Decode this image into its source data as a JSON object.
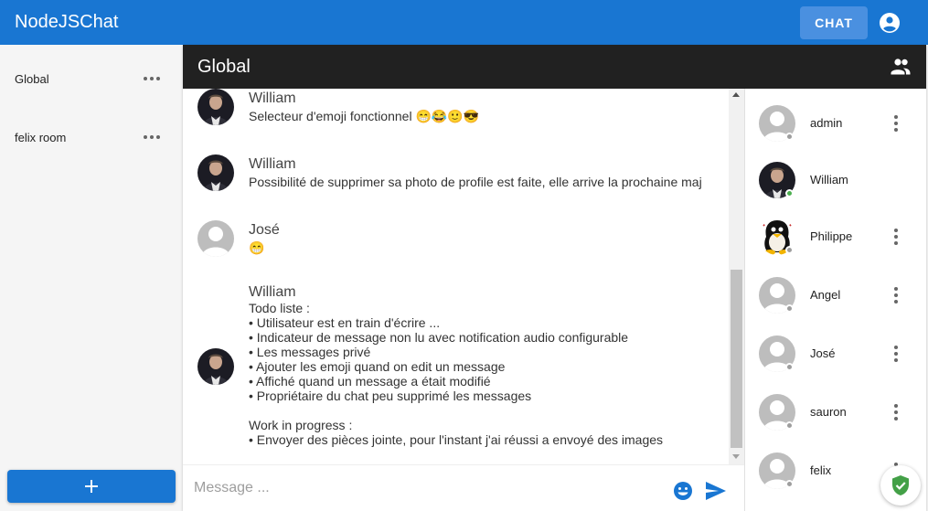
{
  "app": {
    "title": "NodeJSChat",
    "chat_button_label": "CHAT",
    "colors": {
      "primary": "#1976d2",
      "header_dark": "#212121",
      "online": "#4caf50",
      "offline": "#9e9e9e"
    }
  },
  "sidebar": {
    "rooms": [
      {
        "label": "Global"
      },
      {
        "label": "felix room"
      }
    ],
    "add_button_label": "+"
  },
  "chat": {
    "title": "Global",
    "messages": [
      {
        "author": "William",
        "avatar": "photo",
        "lines": [
          "Selecteur d'emoji fonctionnel 😁😂🙂😎"
        ]
      },
      {
        "author": "William",
        "avatar": "photo",
        "lines": [
          "Possibilité de supprimer sa photo de profile est faite, elle arrive la prochaine maj"
        ]
      },
      {
        "author": "José",
        "avatar": "default",
        "lines": [
          "😁"
        ]
      },
      {
        "author": "William",
        "avatar": "photo",
        "lines": [
          "Todo liste :",
          "• Utilisateur est en train d'écrire ...",
          "• Indicateur de message non lu avec notification audio configurable",
          "• Les messages privé",
          "• Ajouter les emoji quand on edit un message",
          "• Affiché quand un message a était modifié",
          "• Propriétaire du chat peu supprimé les messages",
          "",
          "Work in progress :",
          "• Envoyer des pièces jointe, pour l'instant j'ai réussi a envoyé des images"
        ]
      }
    ],
    "composer": {
      "placeholder": "Message ...",
      "value": ""
    }
  },
  "users": [
    {
      "name": "admin",
      "avatar": "default",
      "status": "offline",
      "has_menu": true
    },
    {
      "name": "William",
      "avatar": "photo",
      "status": "online",
      "has_menu": false
    },
    {
      "name": "Philippe",
      "avatar": "penguin",
      "status": "offline",
      "has_menu": true
    },
    {
      "name": "Angel",
      "avatar": "default",
      "status": "offline",
      "has_menu": true
    },
    {
      "name": "José",
      "avatar": "default",
      "status": "offline",
      "has_menu": true
    },
    {
      "name": "sauron",
      "avatar": "default",
      "status": "offline",
      "has_menu": true
    },
    {
      "name": "felix",
      "avatar": "default",
      "status": "offline",
      "has_menu": true
    }
  ]
}
